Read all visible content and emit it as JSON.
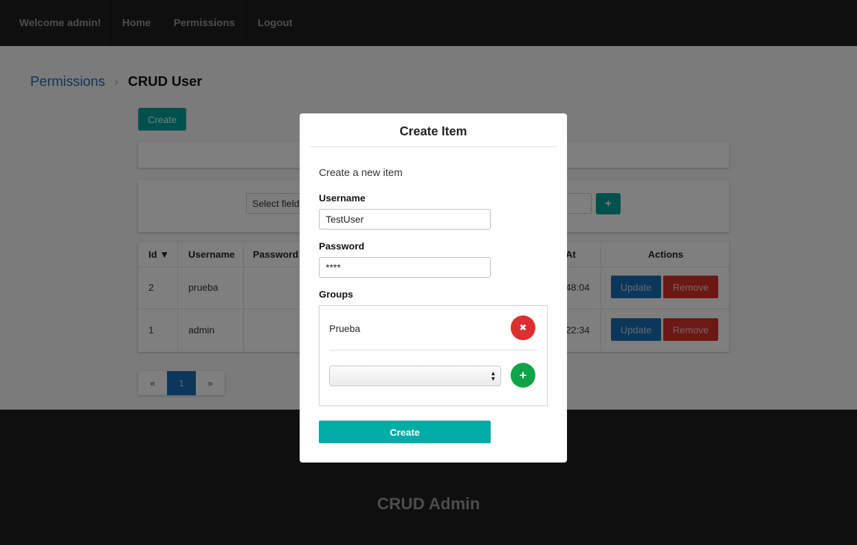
{
  "nav": {
    "welcome": "Welcome admin!",
    "home": "Home",
    "permissions": "Permissions",
    "logout": "Logout"
  },
  "breadcrumb": {
    "parent": "Permissions",
    "separator": "›",
    "current": "CRUD User"
  },
  "toolbar": {
    "create_label": "Create"
  },
  "filter": {
    "select_label": "Select field",
    "add_label": "+"
  },
  "table": {
    "columns": {
      "id": "Id ▼",
      "username": "Username",
      "password": "Password",
      "at": "At",
      "actions": "Actions"
    },
    "rows": [
      {
        "id": "2",
        "username": "prueba",
        "time": "48:04",
        "update": "Update",
        "remove": "Remove"
      },
      {
        "id": "1",
        "username": "admin",
        "time": "22:34",
        "update": "Update",
        "remove": "Remove"
      }
    ]
  },
  "pagination": {
    "prev": "«",
    "current": "1",
    "next": "»"
  },
  "footer": {
    "title": "CRUD Admin"
  },
  "modal": {
    "title": "Create Item",
    "subtitle": "Create a new item",
    "username_label": "Username",
    "username_value": "TestUser",
    "password_label": "Password",
    "password_value": "****",
    "groups_label": "Groups",
    "groups": [
      "Prueba"
    ],
    "remove_group_icon": "✖",
    "add_group_icon": "+",
    "submit_label": "Create"
  },
  "colors": {
    "accent": "#00aca5",
    "primary": "#1a6fb5",
    "danger": "#dc2f2f",
    "success": "#0fa34a",
    "nav_bg": "#1f1f1f"
  }
}
